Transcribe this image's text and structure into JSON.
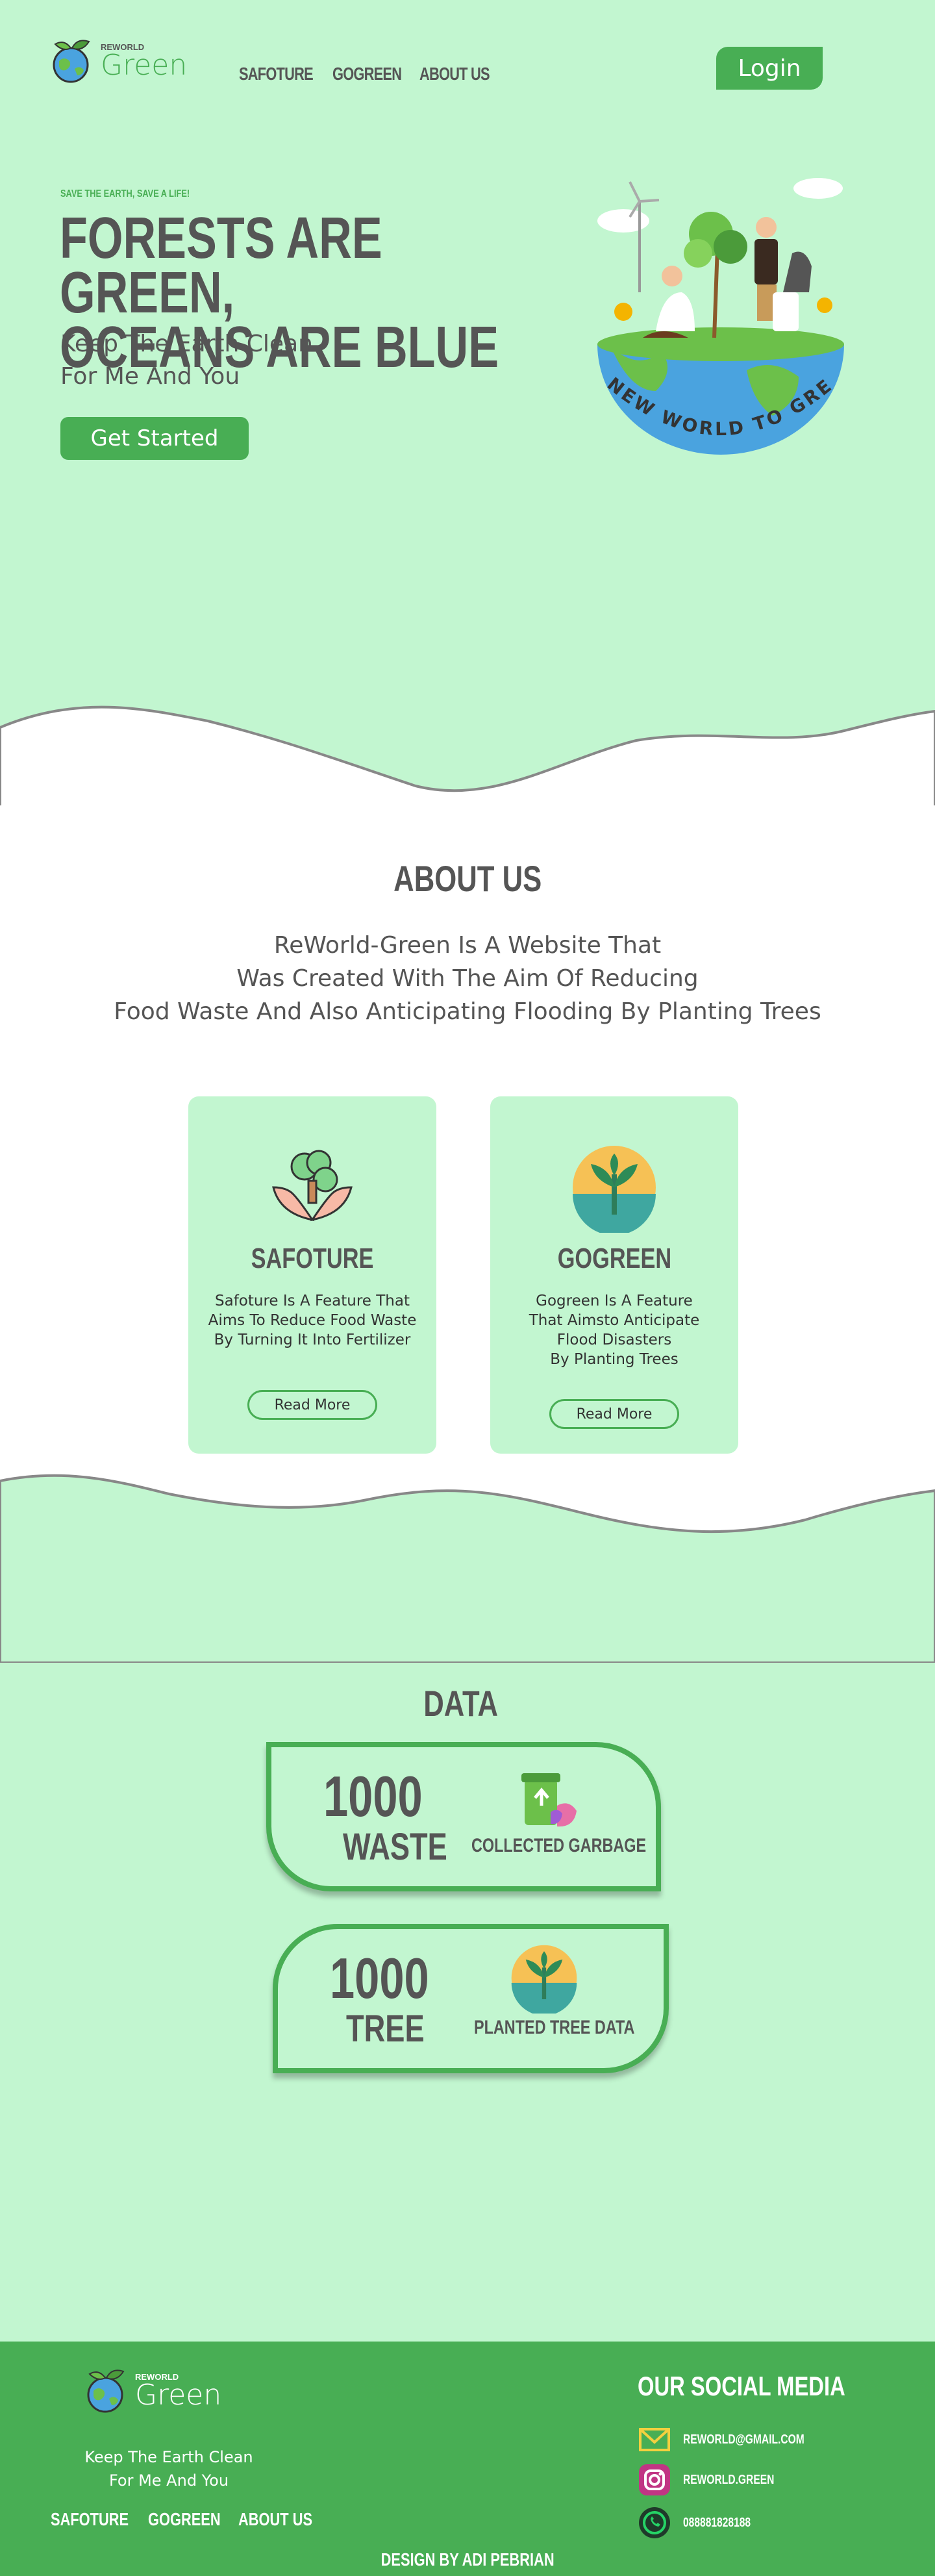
{
  "header": {
    "logo_small": "REWORLD",
    "logo_big": "Green",
    "nav": [
      "SAFOTURE",
      "GOGREEN",
      "ABOUT US"
    ],
    "login_label": "Login"
  },
  "hero": {
    "tagline": "SAVE THE EARTH, SAVE A LIFE!",
    "headline_line1": "FORESTS ARE GREEN,",
    "headline_line2": "OCEANS ARE BLUE",
    "sub_line1": "Keep The Earth Clean",
    "sub_line2": "For Me And You",
    "cta_label": "Get Started",
    "art_caption": "RENEW WORLD TO GREEN"
  },
  "about": {
    "title": "ABOUT US",
    "desc_line1": "ReWorld-Green Is A Website That",
    "desc_line2": "Was Created With The Aim Of Reducing",
    "desc_line3": "Food Waste And Also Anticipating Flooding By Planting Trees",
    "cards": [
      {
        "title": "SAFOTURE",
        "icon": "hands-tree-icon",
        "text_lines": [
          "Safoture Is A Feature That",
          "Aims To Reduce Food Waste",
          "By Turning It Into Fertilizer"
        ],
        "button": "Read More"
      },
      {
        "title": "GOGREEN",
        "icon": "sprout-icon",
        "text_lines": [
          "Gogreen Is A Feature",
          "That Aimsto Anticipate",
          "Flood Disasters",
          "By Planting Trees"
        ],
        "button": "Read More"
      }
    ]
  },
  "data_section": {
    "title": "DATA",
    "stats": [
      {
        "number": "1000",
        "unit": "WASTE",
        "label": "COLLECTED GARBAGE",
        "icon": "recycle-bin-icon"
      },
      {
        "number": "1000",
        "unit": "TREE",
        "label": "PLANTED TREE DATA",
        "icon": "sprout-icon"
      }
    ]
  },
  "footer": {
    "logo_small": "REWORLD",
    "logo_big": "Green",
    "tag_line1": "Keep The Earth Clean",
    "tag_line2": "For Me And You",
    "nav": [
      "SAFOTURE",
      "GOGREEN",
      "ABOUT US"
    ],
    "social_title": "OUR SOCIAL MEDIA",
    "social": [
      {
        "icon": "email-icon",
        "text": "REWORLD@GMAIL.COM"
      },
      {
        "icon": "instagram-icon",
        "text": "REWORLD.GREEN"
      },
      {
        "icon": "whatsapp-icon",
        "text": "088881828188"
      }
    ],
    "credit": "DESIGN BY ADI PEBRIAN"
  },
  "colors": {
    "mint": "#c2f6d0",
    "green": "#48ae54",
    "text": "#555555"
  }
}
